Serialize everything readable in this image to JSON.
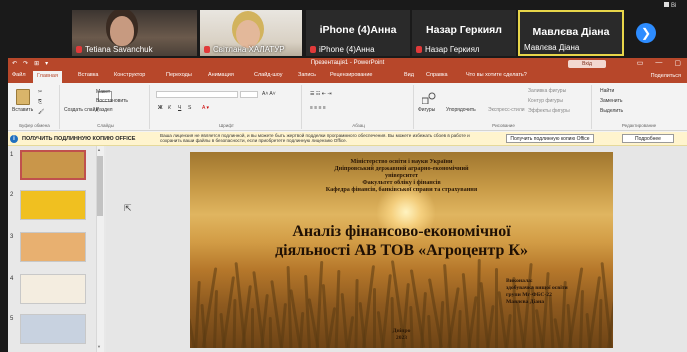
{
  "zoom": {
    "participants": [
      {
        "name": "Tetiana Savanchuk",
        "muted": true
      },
      {
        "name": "Світлана ХАЛАТУР",
        "muted": true
      },
      {
        "name": "iPhone (4)Анна",
        "display": "iPhone (4)Анна",
        "muted": true
      },
      {
        "name": "Назар Геркиял",
        "display": "Назар Геркиял",
        "muted": true
      },
      {
        "name": "Мавлєва Діана",
        "display": "Мавлєва Діана",
        "muted": false
      }
    ],
    "next_icon": "chevron-right-icon",
    "right_label": "Ві"
  },
  "ppt": {
    "window_title": "Презентація1 - PowerPoint",
    "search_label": "Вхід",
    "quick_access": [
      "↶",
      "↷",
      "⊞",
      "▾"
    ],
    "tabs": [
      "Файл",
      "Главная",
      "Вставка",
      "Конструктор",
      "Переходы",
      "Анимация",
      "Слайд-шоу",
      "Запись",
      "Рецензирование",
      "Вид",
      "Справка",
      "Что вы хотите сделать?"
    ],
    "active_tab": "Главная",
    "share_label": "Поделиться",
    "ribbon": {
      "clipboard": {
        "paste": "Вставить",
        "cut": "✂",
        "copy": "⎘",
        "format": "🖌",
        "label": "Буфер обмена"
      },
      "slides": {
        "new": "Создать слайд",
        "layout": "Макет",
        "reset": "Восстановить",
        "section": "Раздел",
        "label": "Слайды"
      },
      "font": {
        "name": "",
        "size": "",
        "bold": "Ж",
        "italic": "К",
        "underline": "Ч",
        "strike": "S",
        "label": "Шрифт"
      },
      "paragraph": {
        "label": "Абзац"
      },
      "drawing": {
        "shapes": "Фигуры",
        "arrange": "Упорядочить",
        "styles": "Экспресс-стили",
        "fill": "Заливка фигуры",
        "outline": "Контур фигуры",
        "effects": "Эффекты фигуры",
        "label": "Рисование"
      },
      "editing": {
        "find": "Найти",
        "replace": "Заменить",
        "select": "Выделить",
        "label": "Редактирование"
      }
    },
    "infobar": {
      "bold": "ПОЛУЧИТЬ ПОДЛИННУЮ КОПИЮ OFFICE",
      "message": "Ваша лицензия не является подлинной, и вы можете быть жертвой подделки программного обеспечения. Вы можете избежать сбоев в работе и сохранить ваши файлы в безопасности, если приобретете подлинную лицензию Office.",
      "get_button": "Получить подлинную копию Office",
      "more_button": "Подробнее"
    },
    "thumbnails": [
      {
        "num": "1",
        "color": "#c9964a"
      },
      {
        "num": "2",
        "color": "#f0c020"
      },
      {
        "num": "3",
        "color": "#e8b070"
      },
      {
        "num": "4",
        "color": "#f4ede0"
      },
      {
        "num": "5",
        "color": "#c8d2e0"
      }
    ],
    "slide": {
      "header_lines": [
        "Міністерство освіти і науки України",
        "Дніпровський державний аграрно-економічний",
        "університет",
        "Факультет обліку і фінансів",
        "Кафедра фінансів, банківської справи та страхування"
      ],
      "title_lines": [
        "Аналіз фінансово-економічної",
        "діяльності АВ ТОВ «Агроцентр К»"
      ],
      "author_lines": [
        "Виконала:",
        "здобувачка вищої освіти",
        "групи Мг-ФБС-22",
        "Мавлєва Діана"
      ],
      "footer_lines": [
        "Дніпро",
        "2023"
      ]
    }
  }
}
